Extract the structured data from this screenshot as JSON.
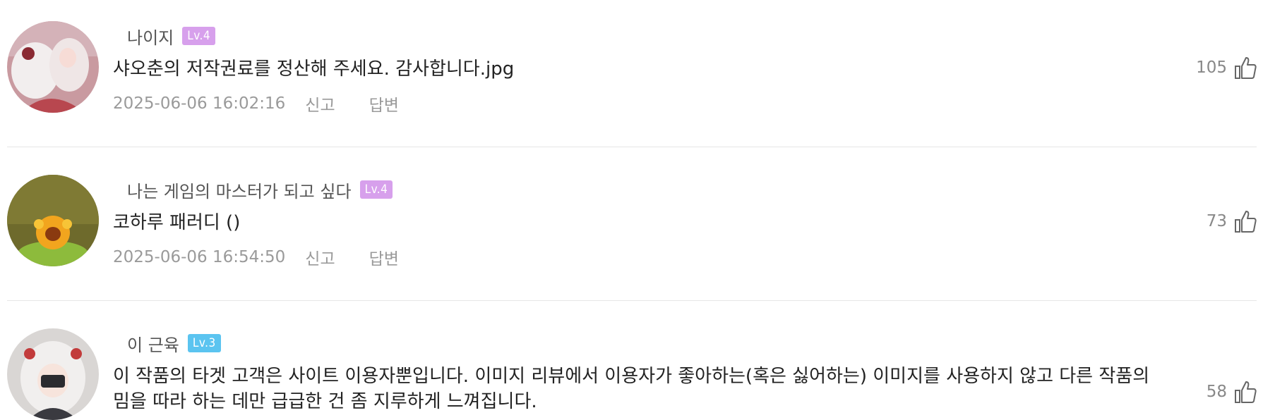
{
  "comments": [
    {
      "username": "나이지",
      "level": "Lv.4",
      "level_color": "#d7a0ec",
      "text": "샤오춘의 저작권료를 정산해 주세요. 감사합니다.jpg",
      "timestamp": "2025-06-06 16:02:16",
      "report_label": "신고",
      "reply_label": "답변",
      "likes": "105",
      "like_icon": "thumbs-up-icon"
    },
    {
      "username": "나는 게임의 마스터가 되고 싶다",
      "level": "Lv.4",
      "level_color": "#d7a0ec",
      "text": "코하루 패러디 ()",
      "timestamp": "2025-06-06 16:54:50",
      "report_label": "신고",
      "reply_label": "답변",
      "likes": "73",
      "like_icon": "thumbs-up-icon"
    },
    {
      "username": "이 근육",
      "level": "Lv.3",
      "level_color": "#5bc4f0",
      "text": "이 작품의 타겟 고객은 사이트 이용자뿐입니다. 이미지 리뷰에서 이용자가 좋아하는(혹은 싫어하는) 이미지를 사용하지 않고 다른 작품의 밈을 따라 하는 데만 급급한 건 좀 지루하게 느껴집니다.",
      "likes": "58",
      "like_icon": "thumbs-up-icon"
    }
  ]
}
